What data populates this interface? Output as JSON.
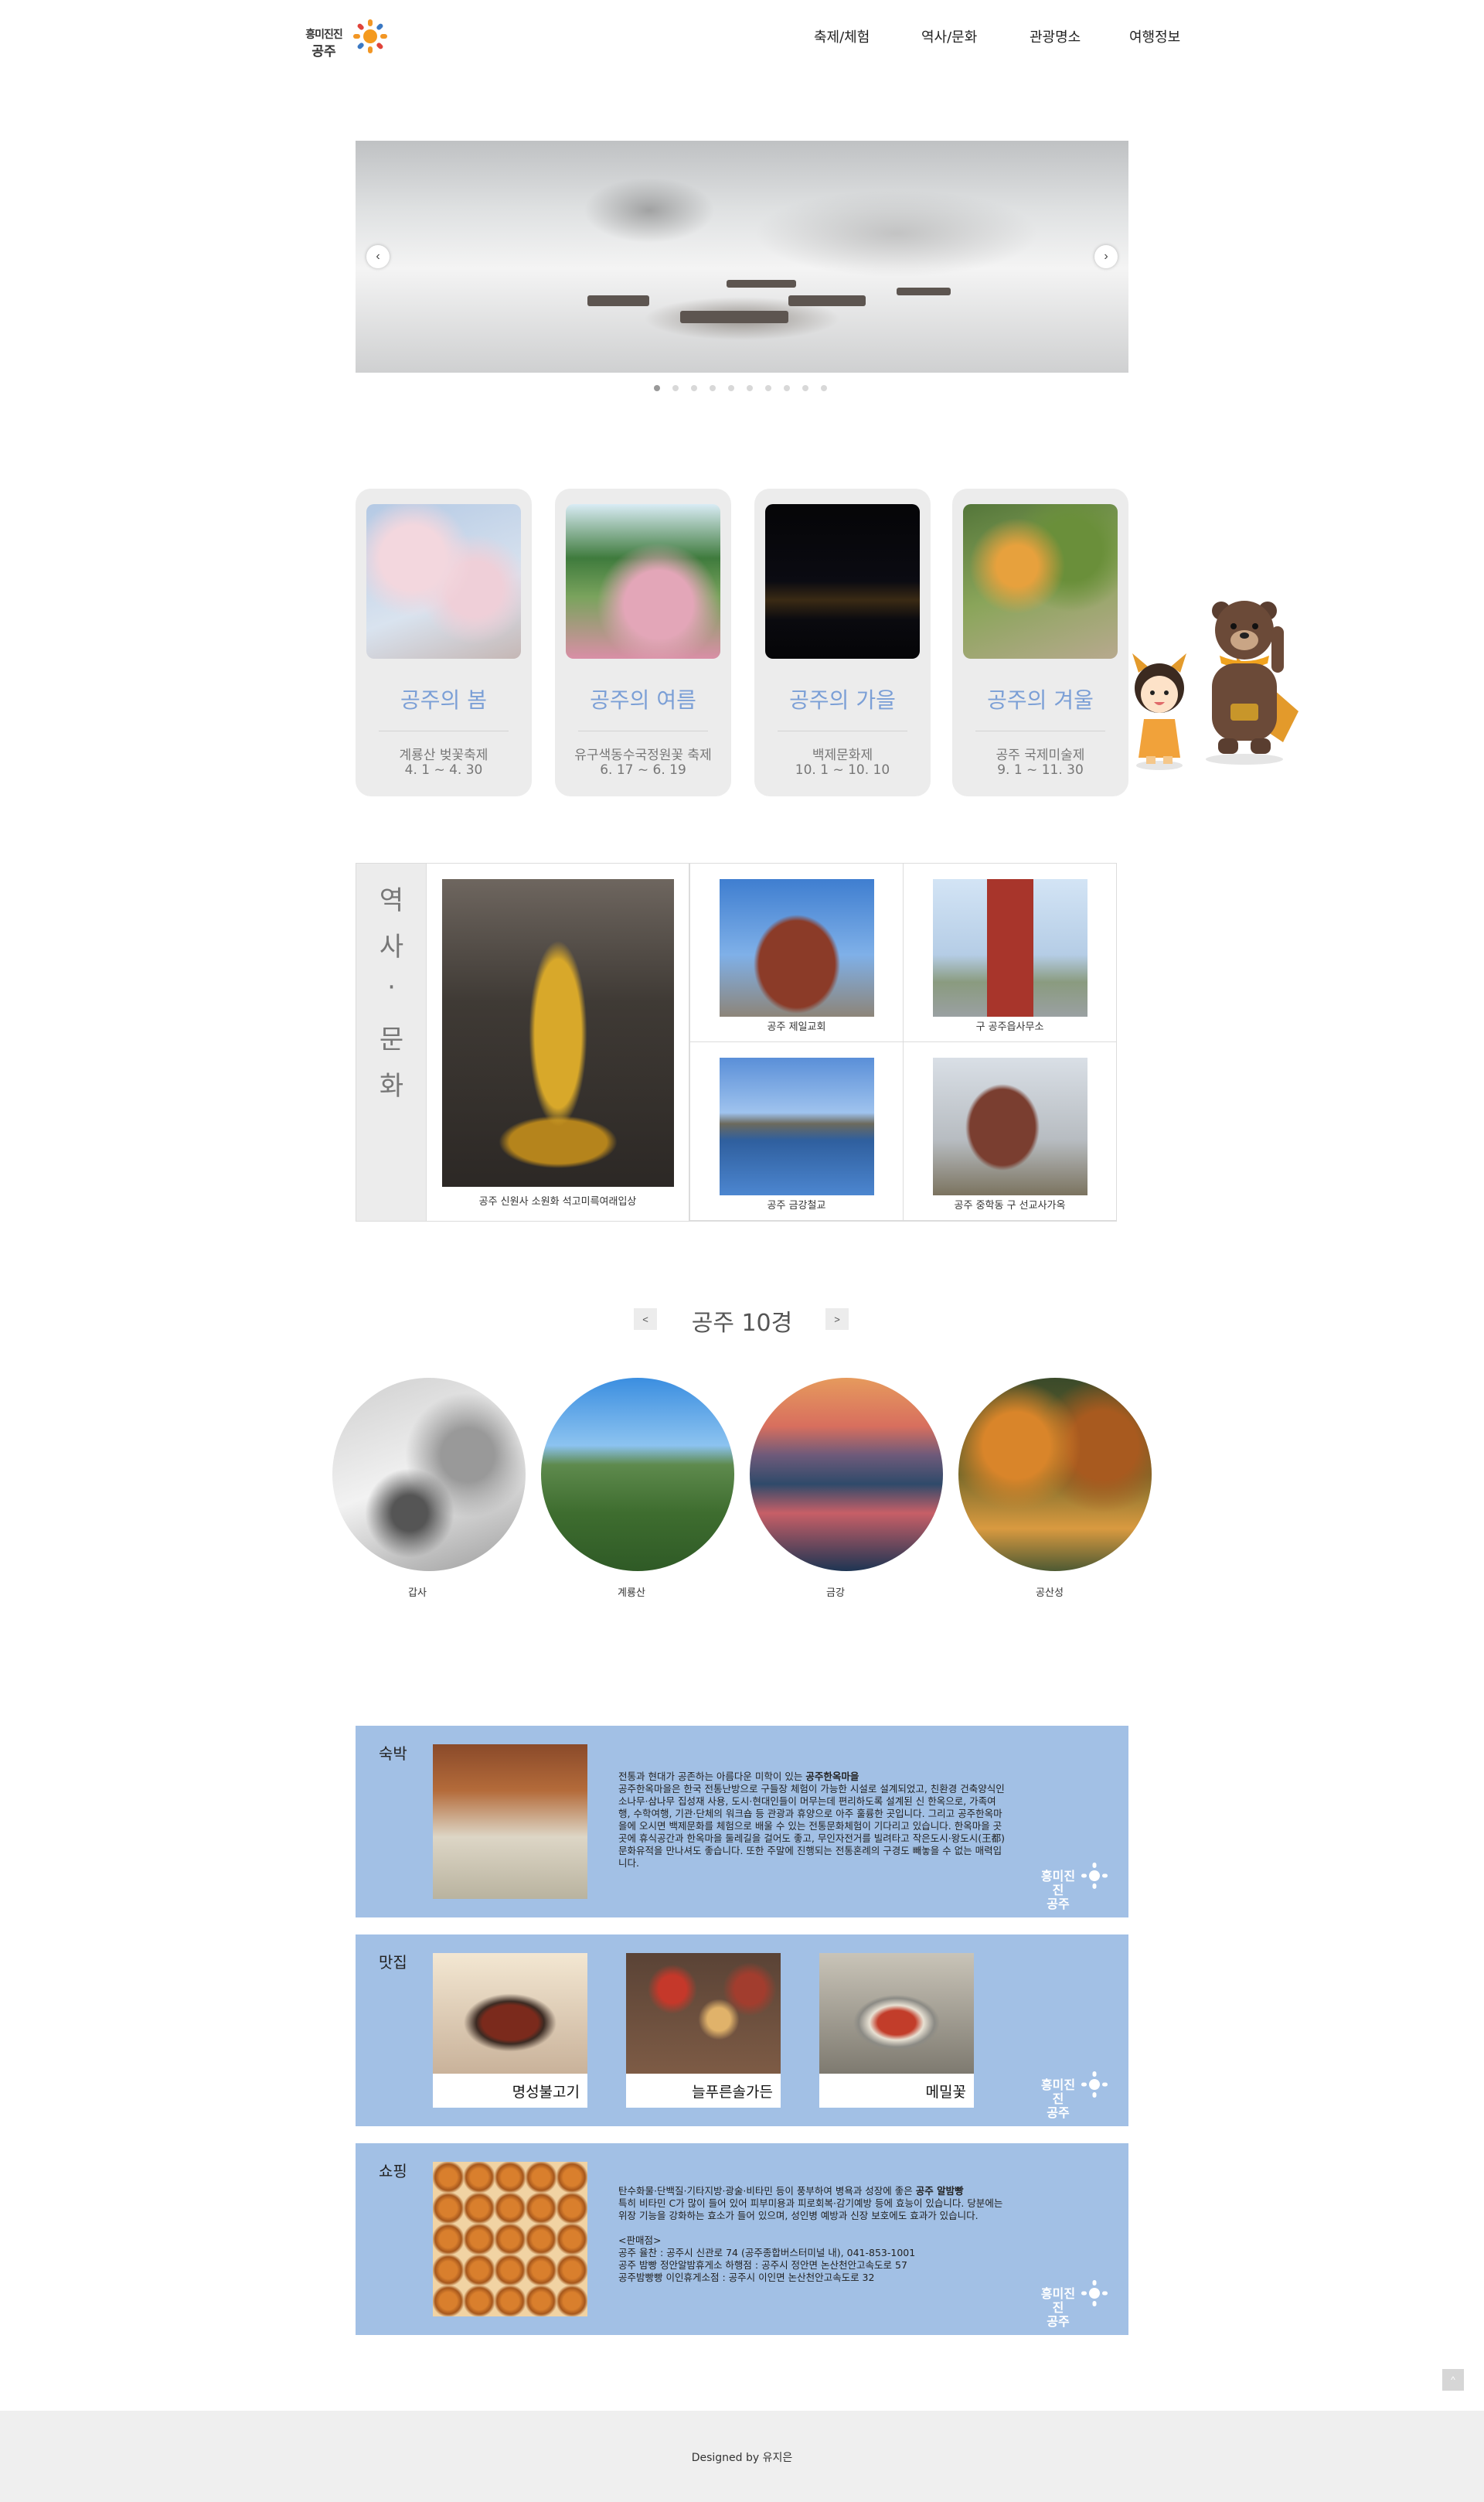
{
  "logo": {
    "line1": "흥미진진",
    "line2": "공주"
  },
  "nav": [
    "축제/체험",
    "역사/문화",
    "관광명소",
    "여행정보"
  ],
  "slider": {
    "prev": "‹",
    "next": "›",
    "dot_count": 10,
    "active_dot": 1
  },
  "seasons": [
    {
      "title": "공주의 봄",
      "name": "계룡산 벚꽃축제",
      "date": "4. 1 ~ 4. 30"
    },
    {
      "title": "공주의 여름",
      "name": "유구색동수국정원꽃 축제",
      "date": "6. 17 ~ 6. 19"
    },
    {
      "title": "공주의 가을",
      "name": "백제문화제",
      "date": "10. 1 ~ 10. 10"
    },
    {
      "title": "공주의 겨울",
      "name": "공주 국제미술제",
      "date": "9. 1 ~ 11. 30"
    }
  ],
  "history": {
    "label": [
      "역",
      "사",
      "·",
      "문",
      "화"
    ],
    "feature_caption": "공주 신원사 소원화 석고미륵여래입상",
    "items": [
      "공주 제일교회",
      "구 공주읍사무소",
      "공주 금강철교",
      "공주 중학동 구 선교사가옥"
    ]
  },
  "ten_views": {
    "title": "공주 10경",
    "prev": "<",
    "next": ">",
    "items": [
      "갑사",
      "계룡산",
      "금강",
      "공산성"
    ]
  },
  "stay": {
    "title": "숙박",
    "text_intro": "전통과 현대가 공존하는 아름다운 미학이 있는 ",
    "text_bold": "공주한옥마을",
    "text_body": "공주한옥마을은 한국 전통난방으로 구들장 체험이 가능한 시설로 설계되었고, 친환경 건축양식인 소나무·삼나무 집성재 사용, 도시·현대인들이 머무는데 편리하도록 설계된 신 한옥으로, 가족여행, 수학여행, 기관·단체의 워크숍 등 관광과 휴양으로 아주 훌륭한 곳입니다. 그리고 공주한옥마을에 오시면 백제문화를 체험으로 배울 수 있는 전통문화체험이 기다리고 있습니다. 한옥마을 곳곳에 휴식공간과 한옥마을 둘레길을 걸어도 좋고, 무인자전거를 빌려타고 작은도시·왕도시(王都) 문화유적을 만나셔도 좋습니다. 또한 주말에 진행되는 전통혼례의 구경도 빼놓을 수 없는 매력입니다."
  },
  "food": {
    "title": "맛집",
    "items": [
      "명성불고기",
      "늘푸른솔가든",
      "메밀꽃"
    ]
  },
  "shop": {
    "title": "쇼핑",
    "text_intro": "탄수화물·단백질·기타지방·광술·비타민 등이 풍부하여 병욕과 성장에 좋은 ",
    "text_bold": "공주 알밤빵",
    "text_body": "특히 비타민 C가 많이 들어 있어 피부미용과 피로회복·감기예방 등에 효능이 있습니다. 당분에는 위장 기능을 강화하는 효소가 들어 있으며, 성인병 예방과 신장 보호에도 효과가 있습니다.",
    "info_title": "<판매점>",
    "info1": "공주 율찬 : 공주시 신관로 74 (공주종합버스터미널 내), 041-853-1001",
    "info2": "공주 밤빵 정안알밤휴게소 하행점 : 공주시 정안면 논산천안고속도로 57",
    "info3": "공주밤빵빵 이인휴게소점 : 공주시 이인면 논산천안고속도로 32"
  },
  "top_button": "^",
  "footer": "Designed by 유지은",
  "colors": {
    "accent": "#7b9fd6",
    "panel": "#a2c0e5",
    "card": "#ececec"
  }
}
